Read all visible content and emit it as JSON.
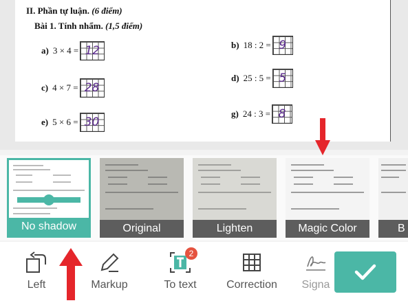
{
  "document": {
    "section_title": "II. Phần tự luận.",
    "section_points": "(6 điểm)",
    "exercise_title": "Bài 1. Tính nhẩm.",
    "exercise_points": "(1,5 điểm)",
    "problems": [
      {
        "letter": "a)",
        "expr": "3 × 4 =",
        "answer": "12"
      },
      {
        "letter": "c)",
        "expr": "4 × 7 =",
        "answer": "28"
      },
      {
        "letter": "e)",
        "expr": "5 × 6 =",
        "answer": "30"
      },
      {
        "letter": "b)",
        "expr": "18 : 2 =",
        "answer": "9"
      },
      {
        "letter": "d)",
        "expr": "25 : 5 =",
        "answer": "5"
      },
      {
        "letter": "g)",
        "expr": "24 : 3 =",
        "answer": "8"
      }
    ]
  },
  "filters": [
    {
      "label": "No shadow",
      "selected": true
    },
    {
      "label": "Original",
      "selected": false
    },
    {
      "label": "Lighten",
      "selected": false
    },
    {
      "label": "Magic Color",
      "selected": false
    },
    {
      "label": "B",
      "selected": false
    }
  ],
  "toolbar": {
    "items": [
      {
        "label": "Left",
        "icon": "rotate-left-icon"
      },
      {
        "label": "Markup",
        "icon": "pen-icon"
      },
      {
        "label": "To text",
        "icon": "text-recognition-icon",
        "badge": "2"
      },
      {
        "label": "Correction",
        "icon": "grid-icon"
      },
      {
        "label": "Signa",
        "icon": "signature-icon"
      }
    ],
    "confirm_icon": "checkmark-icon"
  },
  "colors": {
    "accent": "#4bb7a6",
    "annotation_arrow": "#e5262b",
    "badge": "#e5533f"
  }
}
